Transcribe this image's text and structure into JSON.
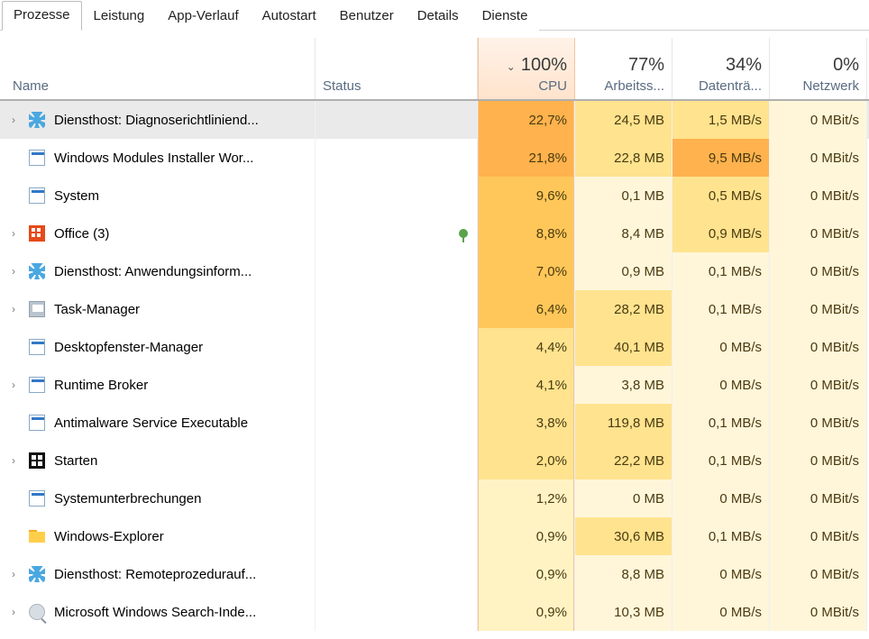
{
  "tabs": [
    {
      "label": "Prozesse",
      "active": true
    },
    {
      "label": "Leistung"
    },
    {
      "label": "App-Verlauf"
    },
    {
      "label": "Autostart"
    },
    {
      "label": "Benutzer"
    },
    {
      "label": "Details"
    },
    {
      "label": "Dienste"
    }
  ],
  "columns": {
    "name": {
      "label": "Name"
    },
    "status": {
      "label": "Status"
    },
    "cpu": {
      "percent": "100%",
      "label": "CPU",
      "sorted": true,
      "sort_dir": "desc"
    },
    "mem": {
      "percent": "77%",
      "label": "Arbeitss..."
    },
    "disk": {
      "percent": "34%",
      "label": "Datenträ..."
    },
    "net": {
      "percent": "0%",
      "label": "Netzwerk"
    }
  },
  "sort_caret": "⌄",
  "rows": [
    {
      "expandable": true,
      "selected": true,
      "icon": "gear",
      "name": "Diensthost: Diagnoserichtliniend...",
      "cpu": "22,7%",
      "mem": "24,5 MB",
      "disk": "1,5 MB/s",
      "net": "0 MBit/s",
      "cpu_heat": "h-cpu-max",
      "mem_heat": "h-mem-hi",
      "disk_heat": "h-disk-hi",
      "net_heat": "h-net-lo"
    },
    {
      "expandable": false,
      "icon": "app",
      "name": "Windows Modules Installer Wor...",
      "cpu": "21,8%",
      "mem": "22,8 MB",
      "disk": "9,5 MB/s",
      "net": "0 MBit/s",
      "cpu_heat": "h-cpu-max",
      "mem_heat": "h-mem-hi",
      "disk_heat": "h-disk-max",
      "net_heat": "h-net-lo"
    },
    {
      "expandable": false,
      "icon": "app",
      "name": "System",
      "cpu": "9,6%",
      "mem": "0,1 MB",
      "disk": "0,5 MB/s",
      "net": "0 MBit/s",
      "cpu_heat": "h-cpu-hi",
      "mem_heat": "h-mem-lo",
      "disk_heat": "h-disk-hi",
      "net_heat": "h-net-lo"
    },
    {
      "expandable": true,
      "icon": "office",
      "name": "Office (3)",
      "leaf": true,
      "cpu": "8,8%",
      "mem": "8,4 MB",
      "disk": "0,9 MB/s",
      "net": "0 MBit/s",
      "cpu_heat": "h-cpu-hi",
      "mem_heat": "h-mem-lo",
      "disk_heat": "h-disk-hi",
      "net_heat": "h-net-lo"
    },
    {
      "expandable": true,
      "icon": "gear",
      "name": "Diensthost: Anwendungsinform...",
      "cpu": "7,0%",
      "mem": "0,9 MB",
      "disk": "0,1 MB/s",
      "net": "0 MBit/s",
      "cpu_heat": "h-cpu-hi",
      "mem_heat": "h-mem-lo",
      "disk_heat": "h-disk-lo",
      "net_heat": "h-net-lo"
    },
    {
      "expandable": true,
      "icon": "taskmgr",
      "name": "Task-Manager",
      "cpu": "6,4%",
      "mem": "28,2 MB",
      "disk": "0,1 MB/s",
      "net": "0 MBit/s",
      "cpu_heat": "h-cpu-hi",
      "mem_heat": "h-mem-hi",
      "disk_heat": "h-disk-lo",
      "net_heat": "h-net-lo"
    },
    {
      "expandable": false,
      "icon": "app",
      "name": "Desktopfenster-Manager",
      "cpu": "4,4%",
      "mem": "40,1 MB",
      "disk": "0 MB/s",
      "net": "0 MBit/s",
      "cpu_heat": "h-cpu-mid",
      "mem_heat": "h-mem-hi",
      "disk_heat": "h-disk-lo",
      "net_heat": "h-net-lo"
    },
    {
      "expandable": true,
      "icon": "app",
      "name": "Runtime Broker",
      "cpu": "4,1%",
      "mem": "3,8 MB",
      "disk": "0 MB/s",
      "net": "0 MBit/s",
      "cpu_heat": "h-cpu-mid",
      "mem_heat": "h-mem-lo",
      "disk_heat": "h-disk-lo",
      "net_heat": "h-net-lo"
    },
    {
      "expandable": false,
      "icon": "app",
      "name": "Antimalware Service Executable",
      "cpu": "3,8%",
      "mem": "119,8 MB",
      "disk": "0,1 MB/s",
      "net": "0 MBit/s",
      "cpu_heat": "h-cpu-mid",
      "mem_heat": "h-mem-hi",
      "disk_heat": "h-disk-lo",
      "net_heat": "h-net-lo"
    },
    {
      "expandable": true,
      "icon": "start",
      "name": "Starten",
      "cpu": "2,0%",
      "mem": "22,2 MB",
      "disk": "0,1 MB/s",
      "net": "0 MBit/s",
      "cpu_heat": "h-cpu-mid",
      "mem_heat": "h-mem-hi",
      "disk_heat": "h-disk-lo",
      "net_heat": "h-net-lo"
    },
    {
      "expandable": false,
      "icon": "app",
      "name": "Systemunterbrechungen",
      "cpu": "1,2%",
      "mem": "0 MB",
      "disk": "0 MB/s",
      "net": "0 MBit/s",
      "cpu_heat": "h-cpu-lo",
      "mem_heat": "h-mem-lo",
      "disk_heat": "h-disk-lo",
      "net_heat": "h-net-lo"
    },
    {
      "expandable": false,
      "icon": "explorer",
      "name": "Windows-Explorer",
      "cpu": "0,9%",
      "mem": "30,6 MB",
      "disk": "0,1 MB/s",
      "net": "0 MBit/s",
      "cpu_heat": "h-cpu-lo",
      "mem_heat": "h-mem-hi",
      "disk_heat": "h-disk-lo",
      "net_heat": "h-net-lo"
    },
    {
      "expandable": true,
      "icon": "gear",
      "name": "Diensthost: Remoteprozedurauf...",
      "cpu": "0,9%",
      "mem": "8,8 MB",
      "disk": "0 MB/s",
      "net": "0 MBit/s",
      "cpu_heat": "h-cpu-lo",
      "mem_heat": "h-mem-lo",
      "disk_heat": "h-disk-lo",
      "net_heat": "h-net-lo"
    },
    {
      "expandable": true,
      "icon": "search",
      "name": "Microsoft Windows Search-Inde...",
      "cpu": "0,9%",
      "mem": "10,3 MB",
      "disk": "0 MB/s",
      "net": "0 MBit/s",
      "cpu_heat": "h-cpu-lo",
      "mem_heat": "h-mem-lo",
      "disk_heat": "h-disk-lo",
      "net_heat": "h-net-lo"
    }
  ]
}
